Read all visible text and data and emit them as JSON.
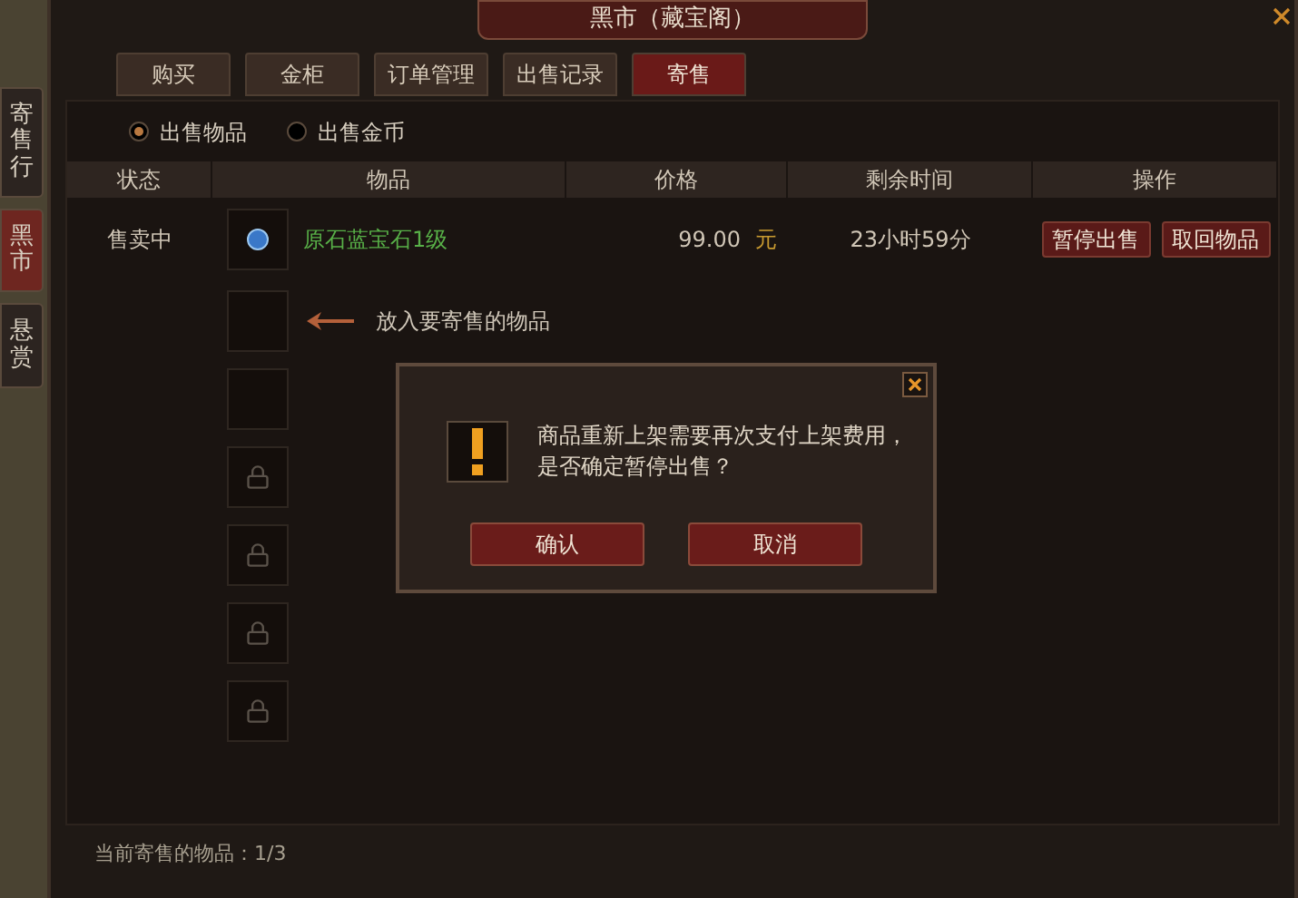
{
  "side_tabs": [
    {
      "label": "寄售行",
      "selected": false
    },
    {
      "label": "黑市",
      "selected": true
    },
    {
      "label": "悬赏",
      "selected": false
    }
  ],
  "window": {
    "title": "黑市（藏宝阁）"
  },
  "tabs": [
    {
      "label": "购买",
      "selected": false
    },
    {
      "label": "金柜",
      "selected": false
    },
    {
      "label": "订单管理",
      "selected": false
    },
    {
      "label": "出售记录",
      "selected": false
    },
    {
      "label": "寄售",
      "selected": true
    }
  ],
  "radios": [
    {
      "label": "出售物品",
      "selected": true
    },
    {
      "label": "出售金币",
      "selected": false
    }
  ],
  "table": {
    "columns": [
      "状态",
      "物品",
      "价格",
      "剩余时间",
      "操作"
    ],
    "rows": [
      {
        "status": "售卖中",
        "item": "原石蓝宝石1级",
        "price": "99.00",
        "currency": "元",
        "time_left": "23小时59分",
        "actions": [
          "暂停出售",
          "取回物品"
        ]
      }
    ]
  },
  "slots": [
    {
      "kind": "empty",
      "hint": "放入要寄售的物品"
    },
    {
      "kind": "empty"
    },
    {
      "kind": "locked"
    },
    {
      "kind": "locked"
    },
    {
      "kind": "locked"
    },
    {
      "kind": "locked"
    }
  ],
  "footer": {
    "label": "当前寄售的物品：",
    "count": "1/3"
  },
  "dialog": {
    "message": "商品重新上架需要再次支付上架费用，是否确定暂停出售？",
    "buttons": [
      "确认",
      "取消"
    ]
  }
}
